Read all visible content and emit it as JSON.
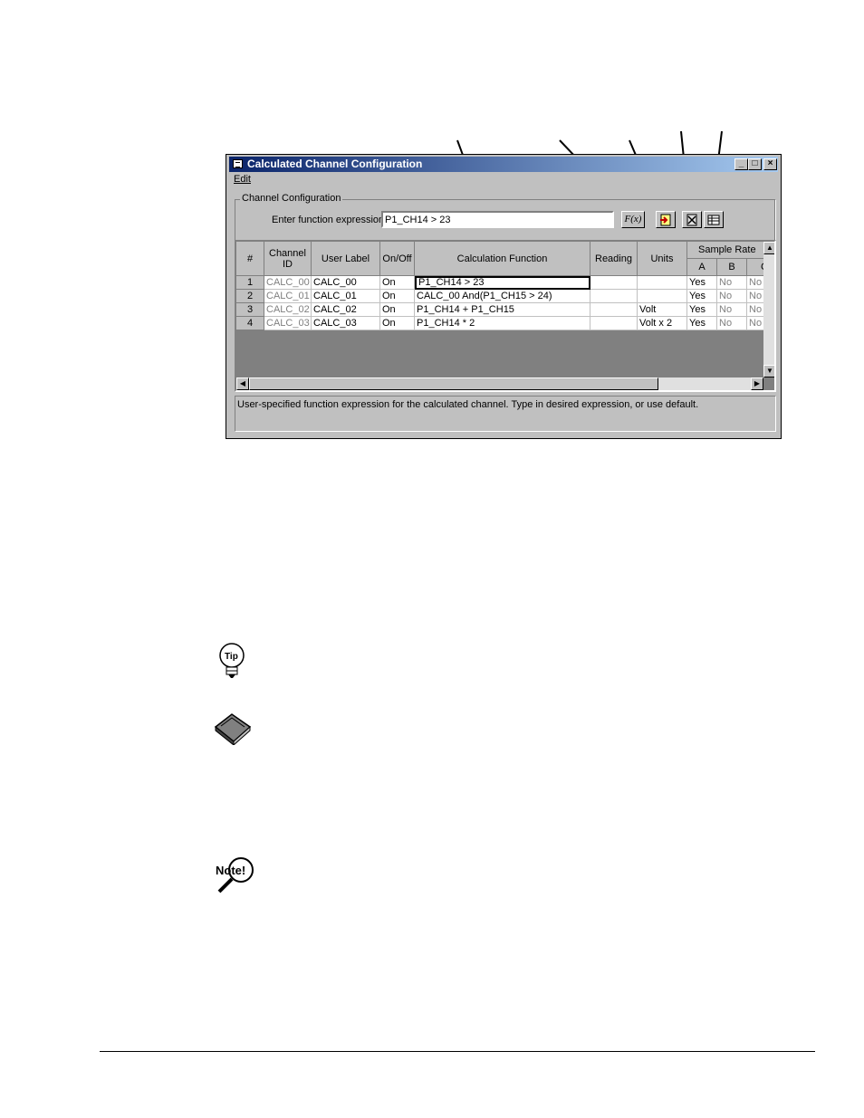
{
  "window": {
    "title": "Calculated Channel Configuration",
    "minimize_glyph": "_",
    "maximize_glyph": "□",
    "close_glyph": "×"
  },
  "menu": {
    "edit": "Edit"
  },
  "group": {
    "label": "Channel Configuration",
    "expression_label": "Enter function expression:",
    "expression_value": "P1_CH14 > 23",
    "fx_button": "F(x)"
  },
  "table": {
    "headers": {
      "num": "#",
      "channel_id": "Channel ID",
      "user_label": "User Label",
      "on_off": "On/Off",
      "calc_function": "Calculation Function",
      "reading": "Reading",
      "units": "Units",
      "sample_rate": "Sample Rate",
      "a": "A",
      "b": "B",
      "c": "C"
    },
    "rows": [
      {
        "num": "1",
        "channel_id": "CALC_00",
        "user_label": "CALC_00",
        "on_off": "On",
        "calc": "P1_CH14 > 23",
        "reading": "",
        "units": "",
        "a": "Yes",
        "b": "No",
        "c": "No"
      },
      {
        "num": "2",
        "channel_id": "CALC_01",
        "user_label": "CALC_01",
        "on_off": "On",
        "calc": "CALC_00 And(P1_CH15 > 24)",
        "reading": "",
        "units": "",
        "a": "Yes",
        "b": "No",
        "c": "No"
      },
      {
        "num": "3",
        "channel_id": "CALC_02",
        "user_label": "CALC_02",
        "on_off": "On",
        "calc": "P1_CH14 + P1_CH15",
        "reading": "",
        "units": "Volt",
        "a": "Yes",
        "b": "No",
        "c": "No"
      },
      {
        "num": "4",
        "channel_id": "CALC_03",
        "user_label": "CALC_03",
        "on_off": "On",
        "calc": "P1_CH14 * 2",
        "reading": "",
        "units": "Volt x 2",
        "a": "Yes",
        "b": "No",
        "c": "No"
      }
    ]
  },
  "status_text": "User-specified function expression for the calculated channel. Type in desired expression, or use default.",
  "icons": {
    "tip": "tip-lightbulb-icon",
    "reference": "reference-book-icon",
    "note": "note-magnifier-icon"
  },
  "tip_label": "Tip",
  "note_label": "Note!"
}
